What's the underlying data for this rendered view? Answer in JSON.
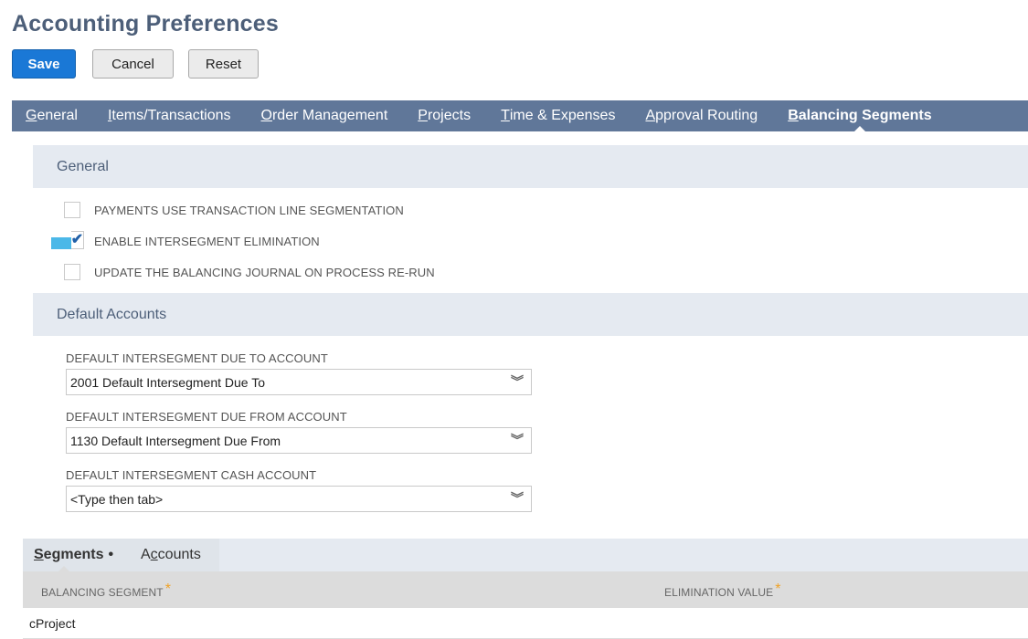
{
  "page": {
    "title": "Accounting Preferences"
  },
  "toolbar": {
    "save_label": "Save",
    "cancel_label": "Cancel",
    "reset_label": "Reset"
  },
  "tabs": [
    {
      "u": "G",
      "rest": "eneral"
    },
    {
      "u": "I",
      "rest": "tems/Transactions"
    },
    {
      "u": "O",
      "rest": "rder Management"
    },
    {
      "u": "P",
      "rest": "rojects"
    },
    {
      "u": "T",
      "rest": "ime & Expenses"
    },
    {
      "u": "A",
      "rest": "pproval Routing"
    },
    {
      "u": "B",
      "rest": "alancing Segments",
      "active": true
    }
  ],
  "general": {
    "heading": "General",
    "options": [
      {
        "label": "PAYMENTS USE TRANSACTION LINE SEGMENTATION",
        "checked": false
      },
      {
        "label": "ENABLE INTERSEGMENT ELIMINATION",
        "checked": true
      },
      {
        "label": "UPDATE THE BALANCING JOURNAL ON PROCESS RE-RUN",
        "checked": false
      }
    ]
  },
  "default_accounts": {
    "heading": "Default Accounts",
    "fields": [
      {
        "label": "DEFAULT INTERSEGMENT DUE TO ACCOUNT",
        "value": "2001 Default Intersegment Due To"
      },
      {
        "label": "DEFAULT INTERSEGMENT DUE FROM ACCOUNT",
        "value": "1130 Default Intersegment Due From"
      },
      {
        "label": "DEFAULT INTERSEGMENT CASH ACCOUNT",
        "value": "<Type then tab>"
      }
    ]
  },
  "subtabs": {
    "segments": {
      "u": "S",
      "rest": "egments",
      "dot": "•"
    },
    "accounts": {
      "pre": "A",
      "u": "c",
      "rest": "counts"
    }
  },
  "grid": {
    "columns": [
      {
        "label": "BALANCING SEGMENT",
        "required": "*"
      },
      {
        "label": "ELIMINATION VALUE",
        "required": "*"
      }
    ],
    "rows": [
      {
        "segment": "cProject",
        "elimination": ""
      }
    ]
  },
  "colors": {
    "primary": "#1a78d6",
    "tabbar": "#607799",
    "section": "#e5eaf1",
    "heading": "#4d5f79",
    "check_highlight": "#4bb8e8",
    "required": "#f0a226"
  }
}
